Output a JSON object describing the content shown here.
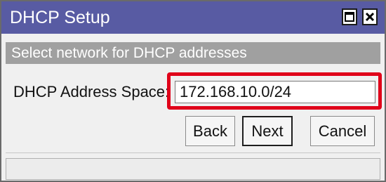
{
  "window": {
    "title": "DHCP Setup"
  },
  "titlebar_buttons": {
    "maximize_icon": "maximize-icon",
    "close_glyph": "✕"
  },
  "section": {
    "heading": "Select network for DHCP addresses"
  },
  "form": {
    "address_label": "DHCP Address Space:",
    "address_value": "172.168.10.0/24"
  },
  "buttons": {
    "back": "Back",
    "next": "Next",
    "cancel": "Cancel"
  },
  "status": {
    "text": ""
  },
  "colors": {
    "titlebar": "#585ba3",
    "subheader": "#a0a0a0",
    "highlight": "#e0001a"
  }
}
